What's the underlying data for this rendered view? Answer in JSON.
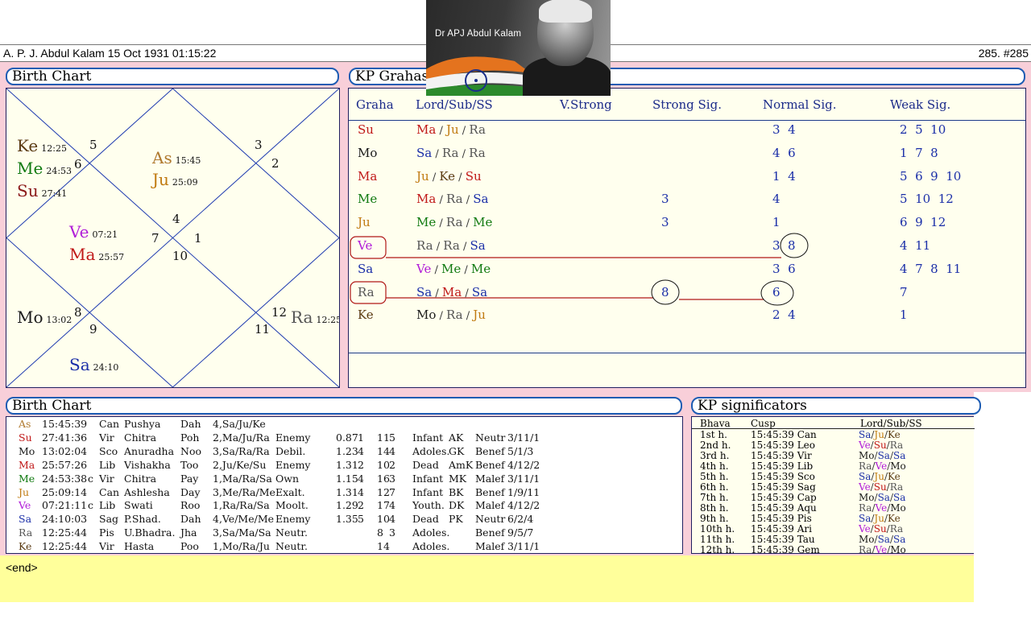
{
  "header": {
    "title": "A. P. J. Abdul Kalam 15 Oct 1931 01:15:22",
    "record": "285. #285"
  },
  "photo_caption": "Dr APJ Abdul Kalam",
  "birth_chart_panel": {
    "title": "Birth Chart",
    "houses": [
      "1",
      "2",
      "3",
      "4",
      "5",
      "6",
      "7",
      "8",
      "9",
      "10",
      "11",
      "12"
    ],
    "planets": [
      {
        "name": "Ke",
        "deg": "12:25",
        "color": "#5a3a12"
      },
      {
        "name": "Me",
        "deg": "24:53",
        "color": "#117a11"
      },
      {
        "name": "Su",
        "deg": "27:41",
        "color": "#8b1a1a"
      },
      {
        "name": "As",
        "deg": "15:45",
        "color": "#b07a30"
      },
      {
        "name": "Ju",
        "deg": "25:09",
        "color": "#c07a10"
      },
      {
        "name": "Ve",
        "deg": "07:21",
        "color": "#b01bd8"
      },
      {
        "name": "Ma",
        "deg": "25:57",
        "color": "#c01818"
      },
      {
        "name": "Mo",
        "deg": "13:02",
        "color": "#1a1a1a"
      },
      {
        "name": "Sa",
        "deg": "24:10",
        "color": "#1a2ea8"
      },
      {
        "name": "Ra",
        "deg": "12:25",
        "color": "#555555"
      }
    ]
  },
  "kp_grahas": {
    "title": "KP Grahas",
    "headers": [
      "Graha",
      "Lord/Sub/SS",
      "V.Strong",
      "Strong Sig.",
      "Normal Sig.",
      "Weak Sig."
    ],
    "rows": [
      {
        "graha": "Su",
        "lord": [
          "Ma",
          "Ju",
          "Ra"
        ],
        "vstrong": "",
        "strong": "",
        "normal": "3  4",
        "weak": "2  5  10"
      },
      {
        "graha": "Mo",
        "lord": [
          "Sa",
          "Ra",
          "Ra"
        ],
        "vstrong": "",
        "strong": "",
        "normal": "4  6",
        "weak": "1  7  8"
      },
      {
        "graha": "Ma",
        "lord": [
          "Ju",
          "Ke",
          "Su"
        ],
        "vstrong": "",
        "strong": "",
        "normal": "1  4",
        "weak": "5  6  9  10"
      },
      {
        "graha": "Me",
        "lord": [
          "Ma",
          "Ra",
          "Sa"
        ],
        "vstrong": "",
        "strong": "3",
        "normal": "4",
        "weak": "5  10  12"
      },
      {
        "graha": "Ju",
        "lord": [
          "Me",
          "Ra",
          "Me"
        ],
        "vstrong": "",
        "strong": "3",
        "normal": "1",
        "weak": "6  9  12"
      },
      {
        "graha": "Ve",
        "lord": [
          "Ra",
          "Ra",
          "Sa"
        ],
        "vstrong": "",
        "strong": "",
        "normal": "3",
        "normal_circled": "8",
        "weak": "4  11"
      },
      {
        "graha": "Sa",
        "lord": [
          "Ve",
          "Me",
          "Me"
        ],
        "vstrong": "",
        "strong": "",
        "normal": "3  6",
        "weak": "4  7  8  11"
      },
      {
        "graha": "Ra",
        "lord": [
          "Sa",
          "Ma",
          "Sa"
        ],
        "vstrong": "",
        "strong": "8",
        "normal": "6",
        "weak": "7"
      },
      {
        "graha": "Ke",
        "lord": [
          "Mo",
          "Ra",
          "Ju"
        ],
        "vstrong": "",
        "strong": "",
        "normal": "2  4",
        "weak": "1"
      }
    ]
  },
  "birth_table": {
    "title": "Birth Chart",
    "rows": [
      [
        "As",
        "15:45:39",
        "",
        "Can",
        "Pushya",
        "Dah",
        "4,Sa/Ju/Ke",
        "",
        "",
        "",
        "",
        "",
        "",
        "",
        "",
        ""
      ],
      [
        "Su",
        "27:41:36",
        "",
        "Vir",
        "Chitra",
        "Poh",
        "2,Ma/Ju/Ra",
        "Enemy",
        "0.87",
        "1",
        "11",
        "5",
        "Infant",
        "AK",
        "Neutr",
        "3/11/1"
      ],
      [
        "Mo",
        "13:02:04",
        "",
        "Sco",
        "Anuradha",
        "Noo",
        "3,Sa/Ra/Ra",
        "Debil.",
        "1.23",
        "4",
        "14",
        "4",
        "Adoles.",
        "GK",
        "Benef",
        "5/1/3"
      ],
      [
        "Ma",
        "25:57:26",
        "",
        "Lib",
        "Vishakha",
        "Too",
        "2,Ju/Ke/Su",
        "Enemy",
        "1.31",
        "2",
        "10",
        "2",
        "Dead",
        "AmK",
        "Benef",
        "4/12/2"
      ],
      [
        "Me",
        "24:53:38",
        "c",
        "Vir",
        "Chitra",
        "Pay",
        "1,Ma/Ra/Sa",
        "Own",
        "1.15",
        "4",
        "16",
        "3",
        "Infant",
        "MK",
        "Malef",
        "3/11/1"
      ],
      [
        "Ju",
        "25:09:14",
        "",
        "Can",
        "Ashlesha",
        "Day",
        "3,Me/Ra/Me",
        "Exalt.",
        "1.31",
        "4",
        "12",
        "7",
        "Infant",
        "BK",
        "Benef",
        "1/9/11"
      ],
      [
        "Ve",
        "07:21:11",
        "c",
        "Lib",
        "Swati",
        "Roo",
        "1,Ra/Ra/Sa",
        "Moolt.",
        "1.29",
        "2",
        "17",
        "4",
        "Youth.",
        "DK",
        "Malef",
        "4/12/2"
      ],
      [
        "Sa",
        "24:10:03",
        "",
        "Sag",
        "P.Shad.",
        "Dah",
        "4,Ve/Me/Me",
        "Enemy",
        "1.35",
        "5",
        "10",
        "4",
        "Dead",
        "PK",
        "Neutr",
        "6/2/4"
      ],
      [
        "Ra",
        "12:25:44",
        "",
        "Pis",
        "U.Bhadra.",
        "Jha",
        "3,Sa/Ma/Sa",
        "Neutr.",
        "",
        "",
        "8",
        "3",
        "Adoles.",
        "",
        "Benef",
        "9/5/7"
      ],
      [
        "Ke",
        "12:25:44",
        "",
        "Vir",
        "Hasta",
        "Poo",
        "1,Mo/Ra/Ju",
        "Neutr.",
        "",
        "",
        "14",
        "",
        "Adoles.",
        "",
        "Malef",
        "3/11/1"
      ]
    ]
  },
  "kp_significators": {
    "title": "KP significators",
    "headers": [
      "Bhava",
      "Cusp",
      "Lord/Sub/SS"
    ],
    "rows": [
      {
        "bhava": "1st h.",
        "cusp": "15:45:39 Can",
        "lord": [
          "Sa",
          "Ju",
          "Ke"
        ]
      },
      {
        "bhava": "2nd h.",
        "cusp": "15:45:39 Leo",
        "lord": [
          "Ve",
          "Su",
          "Ra"
        ]
      },
      {
        "bhava": "3rd h.",
        "cusp": "15:45:39 Vir",
        "lord": [
          "Mo",
          "Sa",
          "Sa"
        ]
      },
      {
        "bhava": "4th h.",
        "cusp": "15:45:39 Lib",
        "lord": [
          "Ra",
          "Ve",
          "Mo"
        ]
      },
      {
        "bhava": "5th h.",
        "cusp": "15:45:39 Sco",
        "lord": [
          "Sa",
          "Ju",
          "Ke"
        ]
      },
      {
        "bhava": "6th h.",
        "cusp": "15:45:39 Sag",
        "lord": [
          "Ve",
          "Su",
          "Ra"
        ]
      },
      {
        "bhava": "7th h.",
        "cusp": "15:45:39 Cap",
        "lord": [
          "Mo",
          "Sa",
          "Sa"
        ]
      },
      {
        "bhava": "8th h.",
        "cusp": "15:45:39 Aqu",
        "lord": [
          "Ra",
          "Ve",
          "Mo"
        ]
      },
      {
        "bhava": "9th h.",
        "cusp": "15:45:39 Pis",
        "lord": [
          "Sa",
          "Ju",
          "Ke"
        ]
      },
      {
        "bhava": "10th h.",
        "cusp": "15:45:39 Ari",
        "lord": [
          "Ve",
          "Su",
          "Ra"
        ]
      },
      {
        "bhava": "11th h.",
        "cusp": "15:45:39 Tau",
        "lord": [
          "Mo",
          "Sa",
          "Sa"
        ]
      },
      {
        "bhava": "12th h.",
        "cusp": "15:45:39 Gem",
        "lord": [
          "Ra",
          "Ve",
          "Mo"
        ]
      }
    ]
  },
  "end_text": "<end>",
  "planet_colors": {
    "Su": "#c01818",
    "Mo": "#1a1a1a",
    "Ma": "#c01818",
    "Me": "#117a11",
    "Ju": "#c07a10",
    "Ve": "#b01bd8",
    "Sa": "#1a2ea8",
    "Ra": "#555555",
    "Ke": "#5a3a12",
    "As": "#b07a30"
  }
}
